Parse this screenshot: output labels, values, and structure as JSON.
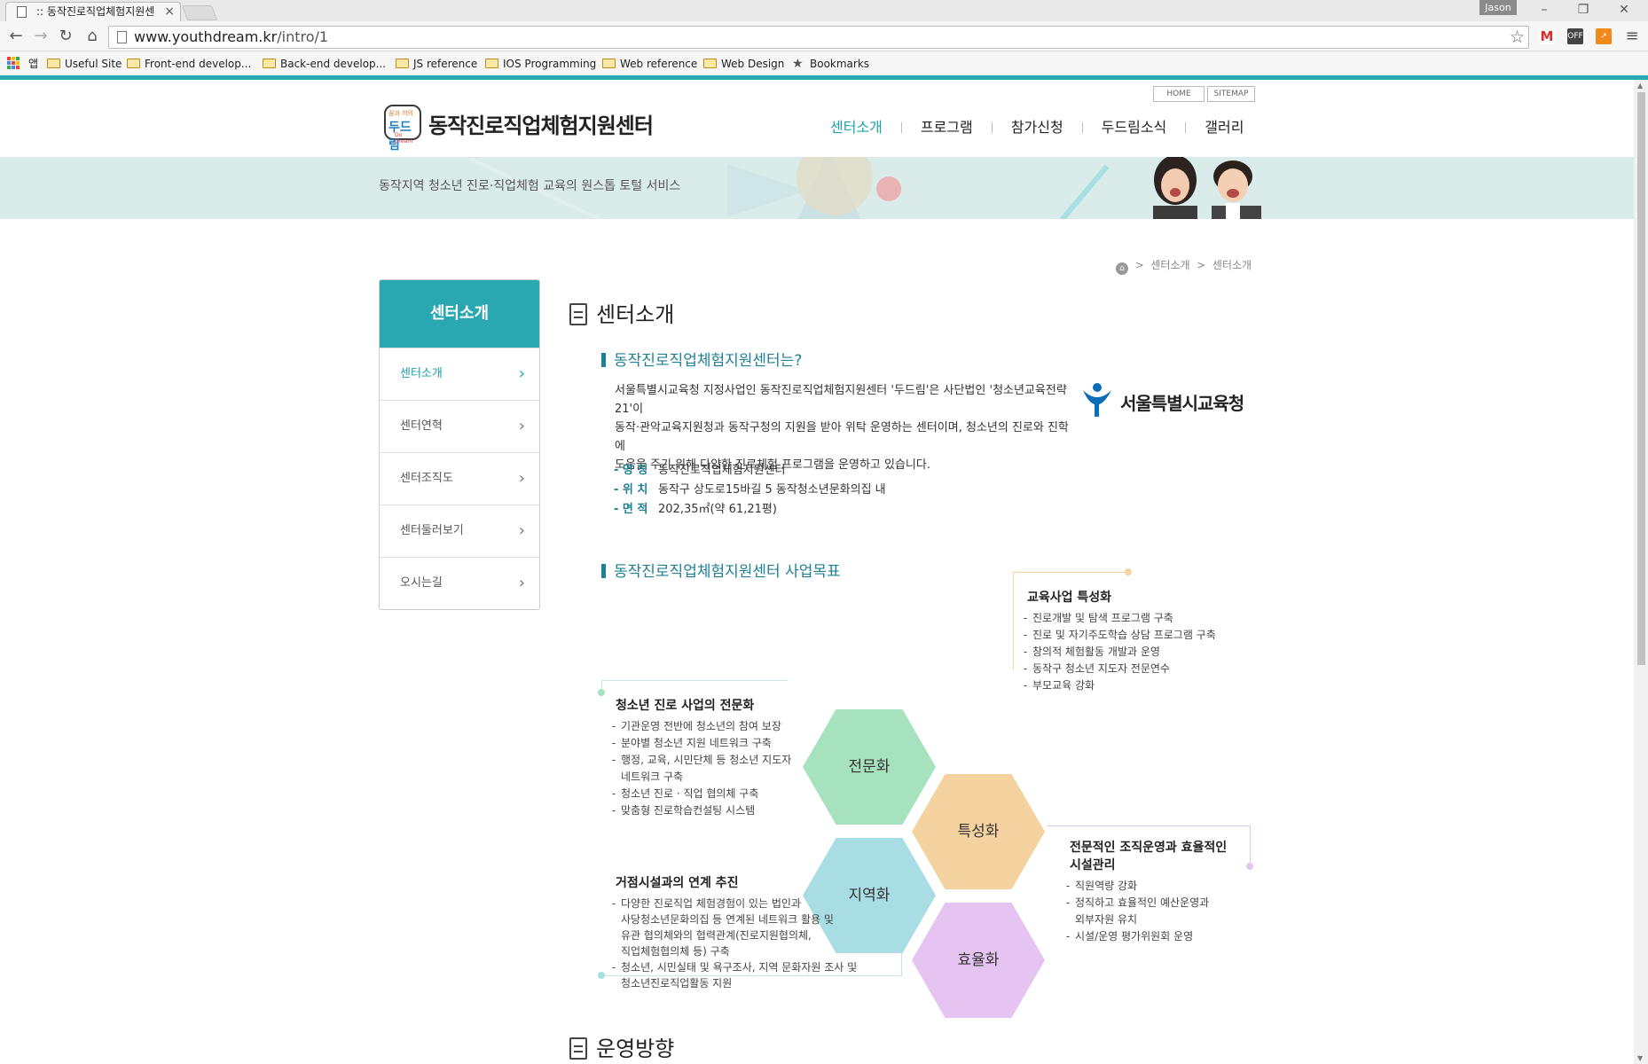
{
  "browser": {
    "tab_title": ":: 동작진로직업체험지원센",
    "profile": "Jason",
    "url_host": "www.youthdream.kr",
    "url_path": "/intro/1",
    "apps_label": "앱",
    "bookmarks": [
      "Useful Site",
      "Front-end develop...",
      "Back-end develop...",
      "JS reference",
      "IOS Programming",
      "Web reference",
      "Web Design",
      "Bookmarks"
    ],
    "ext_off": "OFF",
    "accent_color": "#29a8b2"
  },
  "header": {
    "util_home": "HOME",
    "util_sitemap": "SITEMAP",
    "logo_small": "꿈과 끼의",
    "logo_badge": "두드림",
    "logo_badge_en": "Do Dream",
    "logo_text": "동작진로직업체험지원센터",
    "nav": [
      "센터소개",
      "프로그램",
      "참가신청",
      "두드림소식",
      "갤러리"
    ],
    "tagline": "동작지역 청소년 진로·직업체험 교육의 원스톱 토털 서비스"
  },
  "breadcrumb": {
    "sep": ">",
    "level1": "센터소개",
    "level2": "센터소개"
  },
  "sidebar": {
    "title": "센터소개",
    "items": [
      {
        "label": "센터소개",
        "active": true
      },
      {
        "label": "센터연혁"
      },
      {
        "label": "센터조직도"
      },
      {
        "label": "센터둘러보기"
      },
      {
        "label": "오시는길"
      }
    ]
  },
  "main": {
    "page_title": "센터소개",
    "section1_title": "동작진로직업체험지원센터는?",
    "intro_lines": [
      "서울특별시교육청 지정사업인 동작진로직업체험지원센터 '두드림'은 사단법인 '청소년교육전략21'이",
      "동작·관악교육지원청과 동작구청의 지원을 받아 위탁 운영하는 센터이며, 청소년의 진로와 진학에",
      "도움을 주기 위해 다양한 진로체험 프로그램을 운영하고 있습니다."
    ],
    "seoul_logo_text": "서울특별시교육청",
    "facts": [
      {
        "key": "- 명  칭",
        "value": "동작진로직업체험지원센터"
      },
      {
        "key": "- 위  치",
        "value": "동작구 상도로15바길 5 동작청소년문화의집 내"
      },
      {
        "key": "- 면  적",
        "value": "202,35㎡(약 61,21평)"
      }
    ],
    "section2_title": "동작진로직업체험지원센터 사업목표",
    "section3_title": "운영방향"
  },
  "diagram": {
    "hexes": [
      {
        "label": "전문화",
        "color": "#a7e2bf"
      },
      {
        "label": "특성화",
        "color": "#f4d3a0"
      },
      {
        "label": "지역화",
        "color": "#a9dde4"
      },
      {
        "label": "효율화",
        "color": "#e5c4f1"
      }
    ],
    "box_left_top": {
      "title": "청소년 진로 사업의 전문화",
      "items": [
        "기관운영 전반에 청소년의 참여 보장",
        "분야별 청소년 지원 네트워크 구축",
        "행정, 교육, 시민단체 등 청소년 지도자",
        "네트워크 구축",
        "청소년 진로 · 직업 협의체 구축",
        "맞춤형 진로학습컨설팅 시스템"
      ]
    },
    "box_right_top": {
      "title": "교육사업 특성화",
      "items": [
        "진로개발 및 탐색 프로그램 구축",
        "진로 및 자기주도학습 상담 프로그램 구축",
        "창의적 체험활동 개발과 운영",
        "동작구 청소년 지도자 전문연수",
        "부모교육 강화"
      ]
    },
    "box_left_bottom": {
      "title": "거점시설과의 연계 추진",
      "items": [
        "다양한 진로직업 체험경험이 있는 법인과",
        "사당청소년문화의집 등 연계된 네트워크 활용 및",
        "유관 협의체와의 협력관계(진로지원협의체,",
        "직업체험협의체 등) 구축",
        "청소년, 시민실태 및 욕구조사, 지역 문화자원 조사 및",
        "청소년진로직업활동 지원"
      ]
    },
    "box_right_bottom": {
      "title_line1": "전문적인 조직운영과 효율적인",
      "title_line2": "시설관리",
      "items": [
        "직원역량 강화",
        "정직하고 효율적인 예산운영과",
        "외부자원 유치",
        "시설/운영 평가위원회 운영"
      ]
    }
  }
}
